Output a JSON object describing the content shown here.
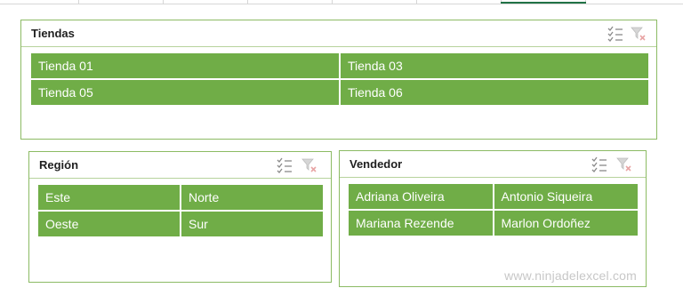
{
  "colors": {
    "item_bg": "#70ad47",
    "item_text": "#ffffff",
    "border": "#8cbb64"
  },
  "slicers": {
    "tiendas": {
      "title": "Tiendas",
      "items": [
        "Tienda 01",
        "Tienda 03",
        "Tienda 05",
        "Tienda 06"
      ],
      "icons": [
        "multiselect-icon",
        "clear-filter-icon"
      ]
    },
    "region": {
      "title": "Región",
      "items": [
        "Este",
        "Norte",
        "Oeste",
        "Sur"
      ],
      "icons": [
        "multiselect-icon",
        "clear-filter-icon"
      ]
    },
    "vendedor": {
      "title": "Vendedor",
      "items": [
        "Adriana Oliveira",
        "Antonio Siqueira",
        "Mariana Rezende",
        "Marlon Ordoñez"
      ],
      "icons": [
        "multiselect-icon",
        "clear-filter-icon"
      ]
    }
  },
  "watermark": "www.ninjadelexcel.com"
}
